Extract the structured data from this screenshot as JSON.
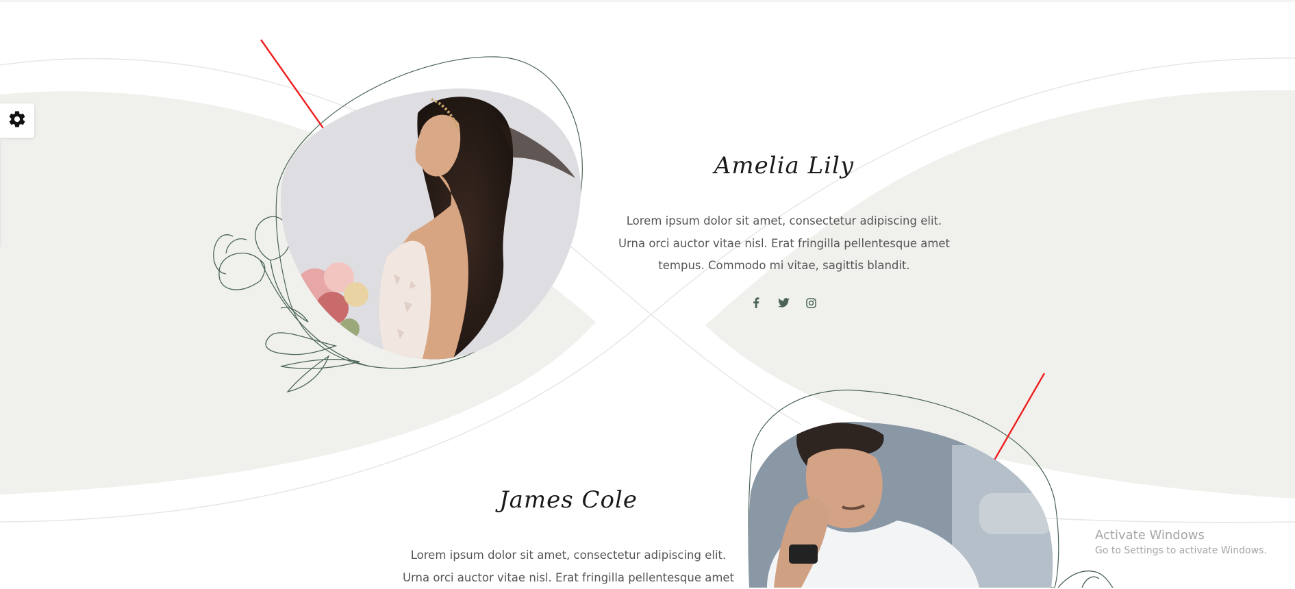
{
  "people": [
    {
      "name": "Amelia Lily",
      "bio_lines": [
        "Lorem ipsum dolor sit amet, consectetur adipiscing elit.",
        "Urna orci auctor vitae nisl. Erat fringilla pellentesque amet",
        "tempus. Commodo mi vitae, sagittis blandit."
      ],
      "socials": [
        "facebook-icon",
        "twitter-icon",
        "instagram-icon"
      ]
    },
    {
      "name": "James Cole",
      "bio_lines": [
        "Lorem ipsum dolor sit amet, consectetur adipiscing elit.",
        "Urna orci auctor vitae nisl. Erat fringilla pellentesque amet"
      ]
    }
  ],
  "watermark": {
    "title": "Activate Windows",
    "subtitle": "Go to Settings to activate Windows."
  },
  "colors": {
    "accent_green": "#4a6355",
    "band_fill": "#f0f1ec",
    "annotation_arrow": "#ee1c1c"
  },
  "icons": {
    "settings": "gear-icon"
  }
}
